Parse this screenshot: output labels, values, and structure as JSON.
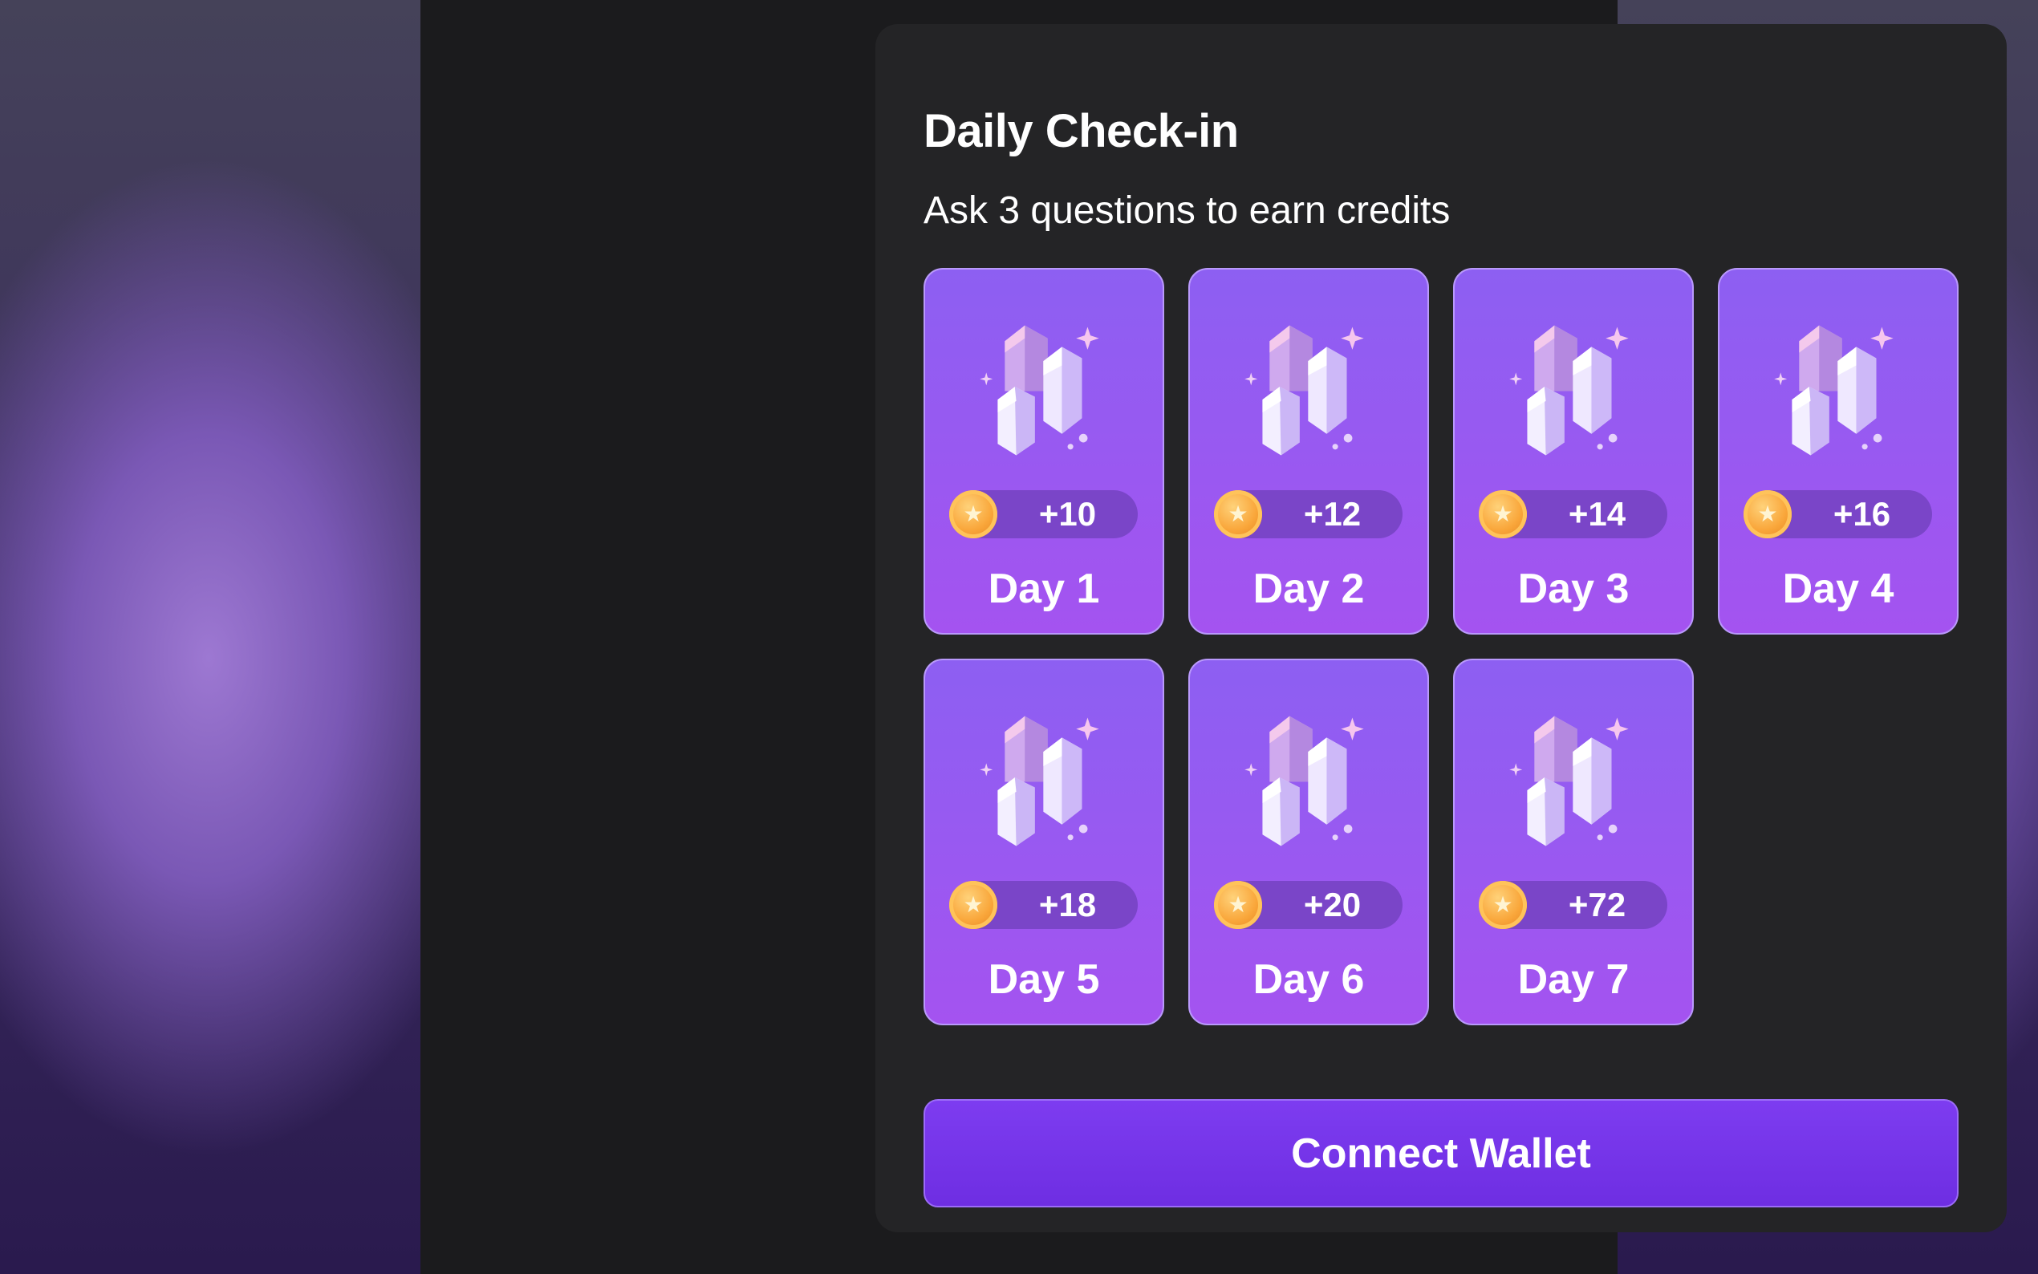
{
  "checkin": {
    "title": "Daily Check-in",
    "subtitle": "Ask 3 questions to earn credits",
    "days": [
      {
        "label": "Day 1",
        "reward": "+10"
      },
      {
        "label": "Day 2",
        "reward": "+12"
      },
      {
        "label": "Day 3",
        "reward": "+14"
      },
      {
        "label": "Day 4",
        "reward": "+16"
      },
      {
        "label": "Day 5",
        "reward": "+18"
      },
      {
        "label": "Day 6",
        "reward": "+20"
      },
      {
        "label": "Day 7",
        "reward": "+72"
      }
    ],
    "connect_label": "Connect Wallet"
  },
  "icons": {
    "reward_art": "crystal-icon",
    "reward_currency": "coin-icon",
    "coin_glyph": "★"
  },
  "colors": {
    "card_gradient_top": "#8d5ff2",
    "card_gradient_bottom": "#a453f0",
    "button": "#7435ea",
    "panel": "#242426"
  }
}
